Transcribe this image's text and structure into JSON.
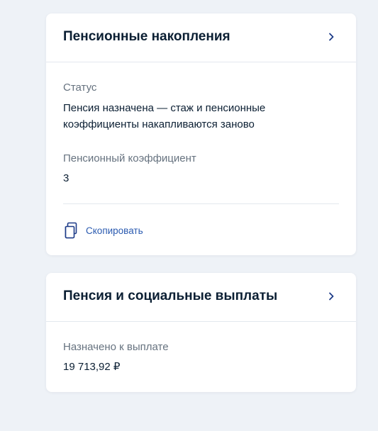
{
  "pension_savings": {
    "title": "Пенсионные накопления",
    "status_label": "Статус",
    "status_value": "Пенсия назначена — стаж и пенсионные коэффициенты накапливаются заново",
    "coefficient_label": "Пенсионный коэффициент",
    "coefficient_value": "3",
    "copy_label": "Скопировать",
    "copy_icon": "copy-icon",
    "chevron_icon": "chevron-right-icon"
  },
  "pension_payments": {
    "title": "Пенсия и социальные выплаты",
    "assigned_label": "Назначено к выплате",
    "assigned_value": "19 713,92 ₽",
    "chevron_icon": "chevron-right-icon"
  },
  "colors": {
    "background": "#eef2f7",
    "card": "#ffffff",
    "text": "#0b1f33",
    "muted_text": "#66727f",
    "accent": "#2a5ab0"
  }
}
